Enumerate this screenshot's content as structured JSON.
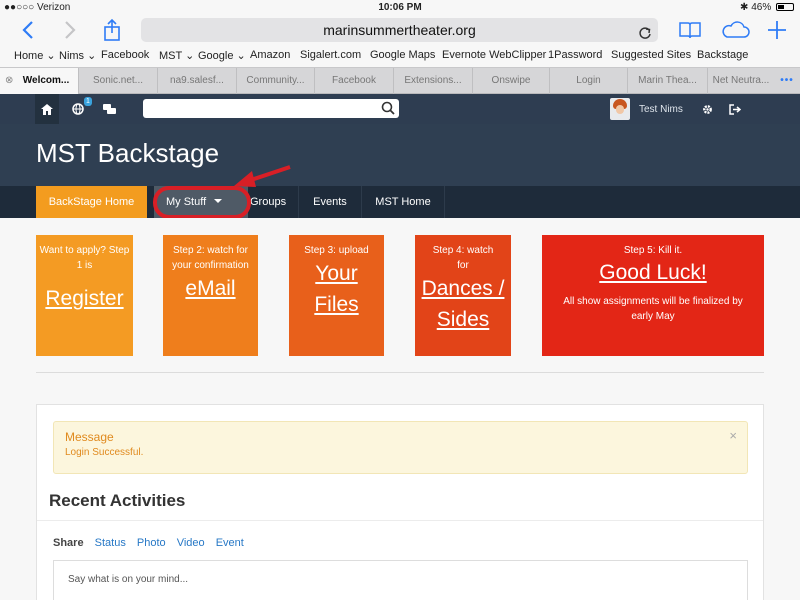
{
  "status_bar": {
    "carrier": "●●○○○ Verizon",
    "time": "10:06 PM",
    "battery": "46%",
    "battery_level": 0.46
  },
  "browser": {
    "url": "marinsummertheater.org",
    "bookmarks": [
      "Home ⌄",
      "Nims ⌄",
      "Facebook",
      "MST ⌄",
      "Google ⌄",
      "Amazon",
      "Sigalert.com",
      "Google Maps",
      "Evernote WebClipper",
      "1Password",
      "Suggested Sites",
      "Backstage"
    ],
    "tabs": [
      "Welcom...",
      "Sonic.net...",
      "na9.salesf...",
      "Community...",
      "Facebook",
      "Extensions...",
      "Onswipe",
      "Login",
      "Marin Thea...",
      "Net Neutra..."
    ],
    "more_tabs": "•••"
  },
  "site": {
    "notification_count": "1",
    "search_placeholder": "",
    "user_name": "Test Nims",
    "title": "MST Backstage",
    "nav": [
      "BackStage Home",
      "My Stuff",
      "Groups",
      "Events",
      "MST Home"
    ],
    "steps": [
      {
        "small": "Want to apply? Step 1 is",
        "big": "Register",
        "color": "#f49b23"
      },
      {
        "small": "Step 2: watch for your confirmation",
        "big": "eMail",
        "color": "#ef7e1c"
      },
      {
        "small": "Step 3: upload",
        "big": "Your Files",
        "color": "#e8601b"
      },
      {
        "small": "Step 4: watch for",
        "big": "Dances / Sides",
        "color": "#e24418"
      },
      {
        "small": "Step 5: Kill it.",
        "big": "Good Luck!",
        "note": "All show assignments will be finalized by early May",
        "color": "#e32616"
      }
    ],
    "alert": {
      "title": "Message",
      "message": "Login Successful.",
      "close": "×"
    },
    "recent_heading": "Recent Activities",
    "share": {
      "label": "Share",
      "options": [
        "Status",
        "Photo",
        "Video",
        "Event"
      ]
    },
    "compose_placeholder": "Say what is on your mind..."
  },
  "colors": {
    "highlight": "#d81f26",
    "header": "#2f3f52",
    "nav_active": "#f39c1f"
  }
}
